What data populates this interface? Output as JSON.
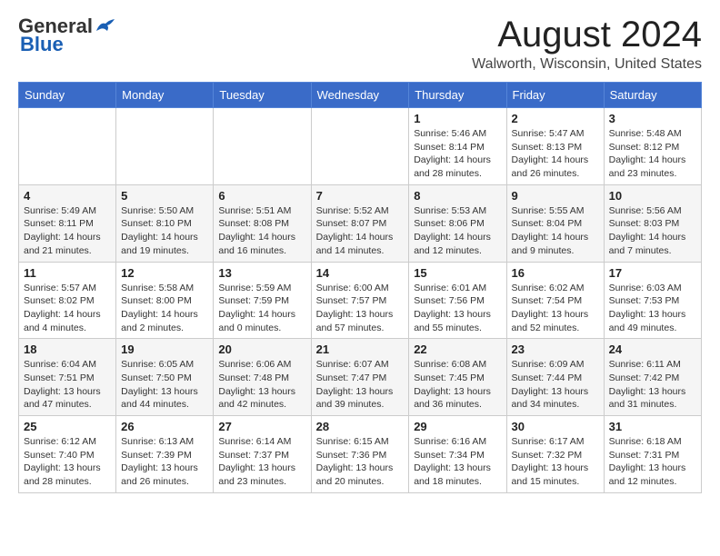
{
  "logo": {
    "general": "General",
    "blue": "Blue"
  },
  "header": {
    "month_year": "August 2024",
    "location": "Walworth, Wisconsin, United States"
  },
  "weekdays": [
    "Sunday",
    "Monday",
    "Tuesday",
    "Wednesday",
    "Thursday",
    "Friday",
    "Saturday"
  ],
  "weeks": [
    [
      {
        "day": "",
        "info": ""
      },
      {
        "day": "",
        "info": ""
      },
      {
        "day": "",
        "info": ""
      },
      {
        "day": "",
        "info": ""
      },
      {
        "day": "1",
        "info": "Sunrise: 5:46 AM\nSunset: 8:14 PM\nDaylight: 14 hours\nand 28 minutes."
      },
      {
        "day": "2",
        "info": "Sunrise: 5:47 AM\nSunset: 8:13 PM\nDaylight: 14 hours\nand 26 minutes."
      },
      {
        "day": "3",
        "info": "Sunrise: 5:48 AM\nSunset: 8:12 PM\nDaylight: 14 hours\nand 23 minutes."
      }
    ],
    [
      {
        "day": "4",
        "info": "Sunrise: 5:49 AM\nSunset: 8:11 PM\nDaylight: 14 hours\nand 21 minutes."
      },
      {
        "day": "5",
        "info": "Sunrise: 5:50 AM\nSunset: 8:10 PM\nDaylight: 14 hours\nand 19 minutes."
      },
      {
        "day": "6",
        "info": "Sunrise: 5:51 AM\nSunset: 8:08 PM\nDaylight: 14 hours\nand 16 minutes."
      },
      {
        "day": "7",
        "info": "Sunrise: 5:52 AM\nSunset: 8:07 PM\nDaylight: 14 hours\nand 14 minutes."
      },
      {
        "day": "8",
        "info": "Sunrise: 5:53 AM\nSunset: 8:06 PM\nDaylight: 14 hours\nand 12 minutes."
      },
      {
        "day": "9",
        "info": "Sunrise: 5:55 AM\nSunset: 8:04 PM\nDaylight: 14 hours\nand 9 minutes."
      },
      {
        "day": "10",
        "info": "Sunrise: 5:56 AM\nSunset: 8:03 PM\nDaylight: 14 hours\nand 7 minutes."
      }
    ],
    [
      {
        "day": "11",
        "info": "Sunrise: 5:57 AM\nSunset: 8:02 PM\nDaylight: 14 hours\nand 4 minutes."
      },
      {
        "day": "12",
        "info": "Sunrise: 5:58 AM\nSunset: 8:00 PM\nDaylight: 14 hours\nand 2 minutes."
      },
      {
        "day": "13",
        "info": "Sunrise: 5:59 AM\nSunset: 7:59 PM\nDaylight: 14 hours\nand 0 minutes."
      },
      {
        "day": "14",
        "info": "Sunrise: 6:00 AM\nSunset: 7:57 PM\nDaylight: 13 hours\nand 57 minutes."
      },
      {
        "day": "15",
        "info": "Sunrise: 6:01 AM\nSunset: 7:56 PM\nDaylight: 13 hours\nand 55 minutes."
      },
      {
        "day": "16",
        "info": "Sunrise: 6:02 AM\nSunset: 7:54 PM\nDaylight: 13 hours\nand 52 minutes."
      },
      {
        "day": "17",
        "info": "Sunrise: 6:03 AM\nSunset: 7:53 PM\nDaylight: 13 hours\nand 49 minutes."
      }
    ],
    [
      {
        "day": "18",
        "info": "Sunrise: 6:04 AM\nSunset: 7:51 PM\nDaylight: 13 hours\nand 47 minutes."
      },
      {
        "day": "19",
        "info": "Sunrise: 6:05 AM\nSunset: 7:50 PM\nDaylight: 13 hours\nand 44 minutes."
      },
      {
        "day": "20",
        "info": "Sunrise: 6:06 AM\nSunset: 7:48 PM\nDaylight: 13 hours\nand 42 minutes."
      },
      {
        "day": "21",
        "info": "Sunrise: 6:07 AM\nSunset: 7:47 PM\nDaylight: 13 hours\nand 39 minutes."
      },
      {
        "day": "22",
        "info": "Sunrise: 6:08 AM\nSunset: 7:45 PM\nDaylight: 13 hours\nand 36 minutes."
      },
      {
        "day": "23",
        "info": "Sunrise: 6:09 AM\nSunset: 7:44 PM\nDaylight: 13 hours\nand 34 minutes."
      },
      {
        "day": "24",
        "info": "Sunrise: 6:11 AM\nSunset: 7:42 PM\nDaylight: 13 hours\nand 31 minutes."
      }
    ],
    [
      {
        "day": "25",
        "info": "Sunrise: 6:12 AM\nSunset: 7:40 PM\nDaylight: 13 hours\nand 28 minutes."
      },
      {
        "day": "26",
        "info": "Sunrise: 6:13 AM\nSunset: 7:39 PM\nDaylight: 13 hours\nand 26 minutes."
      },
      {
        "day": "27",
        "info": "Sunrise: 6:14 AM\nSunset: 7:37 PM\nDaylight: 13 hours\nand 23 minutes."
      },
      {
        "day": "28",
        "info": "Sunrise: 6:15 AM\nSunset: 7:36 PM\nDaylight: 13 hours\nand 20 minutes."
      },
      {
        "day": "29",
        "info": "Sunrise: 6:16 AM\nSunset: 7:34 PM\nDaylight: 13 hours\nand 18 minutes."
      },
      {
        "day": "30",
        "info": "Sunrise: 6:17 AM\nSunset: 7:32 PM\nDaylight: 13 hours\nand 15 minutes."
      },
      {
        "day": "31",
        "info": "Sunrise: 6:18 AM\nSunset: 7:31 PM\nDaylight: 13 hours\nand 12 minutes."
      }
    ]
  ]
}
